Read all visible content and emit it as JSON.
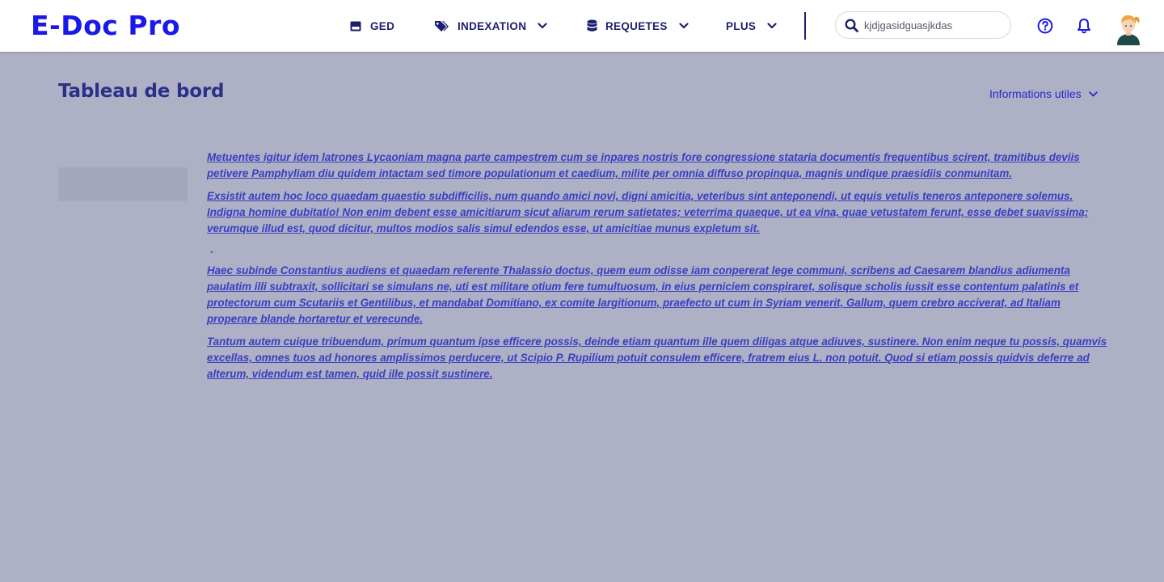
{
  "app": {
    "logo": "E-Doc Pro"
  },
  "nav": {
    "ged": "GED",
    "indexation": "INDEXATION",
    "requetes": "REQUETES",
    "plus": "PLUS"
  },
  "search": {
    "value": "kjdjgasidguasjkdas"
  },
  "page": {
    "title": "Tableau de bord",
    "info_toggle": "Informations utiles"
  },
  "content": {
    "paragraphs": [
      "Metuentes igitur idem latrones Lycaoniam magna parte campestrem cum se inpares nostris fore congressione stataria documentis frequentibus scirent, tramitibus deviis petivere Pamphyliam diu quidem intactam sed timore populationum et caedium, milite per omnia diffuso propinqua, magnis undique praesidiis conmunitam.",
      "Exsistit autem hoc loco quaedam quaestio subdifficilis, num quando amici novi, digni amicitia, veteribus sint anteponendi, ut equis vetulis teneros anteponere solemus. Indigna homine dubitatio! Non enim debent esse amicitiarum sicut aliarum rerum satietates; veterrima quaeque, ut ea vina, quae vetustatem ferunt, esse debet suavissima; verumque illud est, quod dicitur, multos modios salis simul edendos esse, ut amicitiae munus expletum sit.",
      "-",
      "Haec subinde Constantius audiens et quaedam referente Thalassio doctus, quem eum odisse iam conpererat lege communi, scribens ad Caesarem blandius adiumenta paulatim illi subtraxit, sollicitari se simulans ne, uti est militare otium fere tumultuosum, in eius perniciem conspiraret, solisque scholis iussit esse contentum palatinis et protectorum cum Scutariis et Gentilibus, et mandabat Domitiano, ex comite largitionum, praefecto ut cum in Syriam venerit, Gallum, quem crebro acciverat, ad Italiam properare blande hortaretur et verecunde.",
      "Tantum autem cuique tribuendum, primum quantum ipse efficere possis, deinde etiam quantum ille quem diligas atque adiuves, sustinere. Non enim neque tu possis, quamvis excellas, omnes tuos ad honores amplissimos perducere, ut Scipio P. Rupilium potuit consulem efficere, fratrem eius L. non potuit. Quod si etiam possis quidvis deferre ad alterum, videndum est tamen, quid ille possit sustinere."
    ]
  },
  "icons": {
    "ged": "folder-icon",
    "indexation": "tags-icon",
    "requetes": "database-icon",
    "search": "search-icon",
    "help": "help-circle-icon",
    "notifications": "bell-icon",
    "avatar": "user-avatar"
  },
  "colors": {
    "brand": "#1a1ae8",
    "nav_text": "#1c1f6e",
    "overlay": "#aeb0c6",
    "link": "#3a3ec0"
  }
}
